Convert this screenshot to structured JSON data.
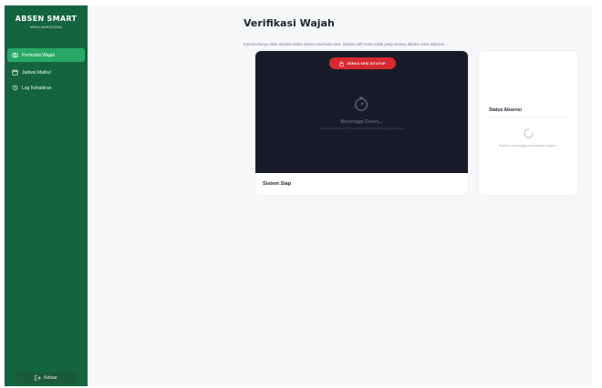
{
  "sidebar": {
    "brand_title": "ABSEN SMART",
    "brand_subtitle": "MENU MAHASISWA",
    "items": [
      {
        "label": "Pemindai Wajah",
        "icon": "camera-icon",
        "active": true
      },
      {
        "label": "Jadwal Matkul",
        "icon": "calendar-icon",
        "active": false
      },
      {
        "label": "Log Kehadiran",
        "icon": "history-icon",
        "active": false
      }
    ],
    "logout_label": "Keluar",
    "logout_icon": "logout-icon"
  },
  "main": {
    "title": "Verifikasi Wajah",
    "description": "Kamera hanya akan terbuka ketika Dosen membuka sesi. Silakan pilih mata kuliah yang sedang dibuka untuk dialosen."
  },
  "camera_panel": {
    "badge": "SEMUA SESI DITUTUP",
    "badge_icon": "lock-icon",
    "center_icon": "stopwatch-icon",
    "waiting_title": "Menunggu Dosen...",
    "waiting_note": "Kamera tertutup. Belum ada sesi absensi yang dibuka.",
    "status": "Sistem Siap"
  },
  "status_panel": {
    "title": "Status Absensi",
    "spinner_icon": "loading-spinner-icon",
    "message": "Sistem menunggu pemindaian wajah..."
  },
  "colors": {
    "sidebar": "#14643f",
    "sidebar_active": "#28a866",
    "camera_bg": "#191c28",
    "badge": "#d62a32",
    "page_bg": "#f6f7f9"
  }
}
